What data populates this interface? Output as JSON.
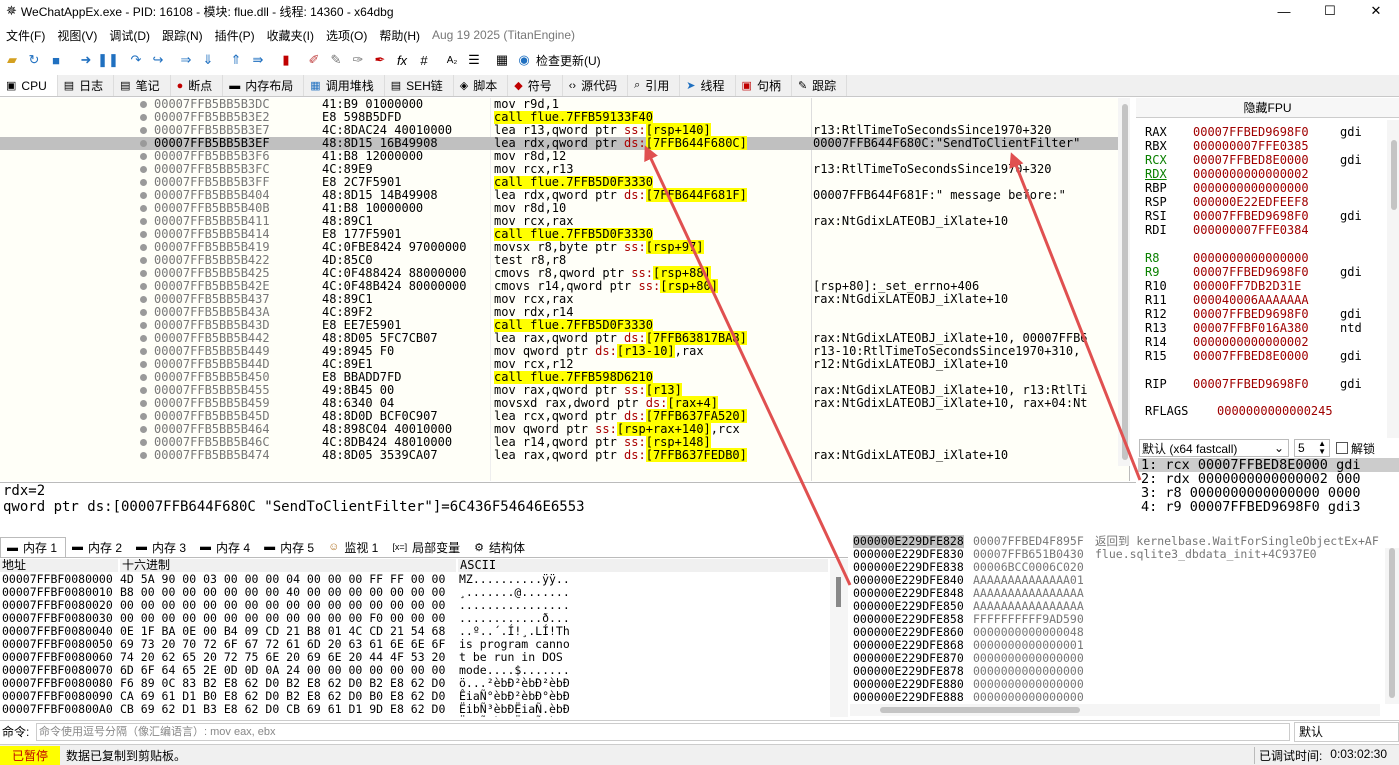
{
  "window": {
    "title": "WeChatAppEx.exe - PID: 16108 - 模块: flue.dll - 线程: 14360 - x64dbg",
    "buttons": [
      "—",
      "☐",
      "✕"
    ]
  },
  "menu": {
    "items": [
      "文件(F)",
      "视图(V)",
      "调试(D)",
      "跟踪(N)",
      "插件(P)",
      "收藏夹(I)",
      "选项(O)",
      "帮助(H)"
    ],
    "version": "Aug 19 2025 (TitanEngine)"
  },
  "toolbar": {
    "update_label": "检查更新(U)"
  },
  "tabs": [
    {
      "icon": "cpu-icon",
      "glyph": "▣",
      "label": "CPU"
    },
    {
      "icon": "log-icon",
      "glyph": "▤",
      "label": "日志"
    },
    {
      "icon": "notes-icon",
      "glyph": "▤",
      "label": "笔记"
    },
    {
      "icon": "breakpoint-icon",
      "glyph": "●",
      "label": "断点"
    },
    {
      "icon": "memory-map-icon",
      "glyph": "▬",
      "label": "内存布局"
    },
    {
      "icon": "callstack-icon",
      "glyph": "▦",
      "label": "调用堆栈"
    },
    {
      "icon": "seh-icon",
      "glyph": "▤",
      "label": "SEH链"
    },
    {
      "icon": "script-icon",
      "glyph": "◈",
      "label": "脚本"
    },
    {
      "icon": "symbol-icon",
      "glyph": "◆",
      "label": "符号"
    },
    {
      "icon": "source-icon",
      "glyph": "‹›",
      "label": "源代码"
    },
    {
      "icon": "references-icon",
      "glyph": "⌕",
      "label": "引用"
    },
    {
      "icon": "threads-icon",
      "glyph": "➤",
      "label": "线程"
    },
    {
      "icon": "handles-icon",
      "glyph": "▣",
      "label": "句柄"
    },
    {
      "icon": "trace-icon",
      "glyph": "✎",
      "label": "跟踪"
    }
  ],
  "disasm": [
    {
      "addr": "00007FFB5BB5B3DC",
      "bytes": "41:B9 01000000",
      "ins": "mov r9d,1",
      "cm": ""
    },
    {
      "addr": "00007FFB5BB5B3E2",
      "bytes": "E8 598B5DFD",
      "ins": "call flue.7FFB59133F40",
      "cm": "",
      "call": true
    },
    {
      "addr": "00007FFB5BB5B3E7",
      "bytes": "4C:8DAC24 40010000",
      "ins": "lea r13,qword ptr ss:[rsp+140]",
      "cm": "r13:RtlTimeToSecondsSince1970+320"
    },
    {
      "addr": "00007FFB5BB5B3EF",
      "bytes": "48:8D15 16B49908",
      "ins": "lea rdx,qword ptr ds:[7FFB644F680C]",
      "cm": "00007FFB644F680C:\"SendToClientFilter\"",
      "sel": true
    },
    {
      "addr": "00007FFB5BB5B3F6",
      "bytes": "41:B8 12000000",
      "ins": "mov r8d,12",
      "cm": ""
    },
    {
      "addr": "00007FFB5BB5B3FC",
      "bytes": "4C:89E9",
      "ins": "mov rcx,r13",
      "cm": "r13:RtlTimeToSecondsSince1970+320"
    },
    {
      "addr": "00007FFB5BB5B3FF",
      "bytes": "E8 2C7F5901",
      "ins": "call flue.7FFB5D0F3330",
      "cm": "",
      "call": true
    },
    {
      "addr": "00007FFB5BB5B404",
      "bytes": "48:8D15 14B49908",
      "ins": "lea rdx,qword ptr ds:[7FFB644F681F]",
      "cm": "00007FFB644F681F:\" message before:\""
    },
    {
      "addr": "00007FFB5BB5B40B",
      "bytes": "41:B8 10000000",
      "ins": "mov r8d,10",
      "cm": ""
    },
    {
      "addr": "00007FFB5BB5B411",
      "bytes": "48:89C1",
      "ins": "mov rcx,rax",
      "cm": "rax:NtGdixLATEOBJ_iXlate+10"
    },
    {
      "addr": "00007FFB5BB5B414",
      "bytes": "E8 177F5901",
      "ins": "call flue.7FFB5D0F3330",
      "cm": "",
      "call": true
    },
    {
      "addr": "00007FFB5BB5B419",
      "bytes": "4C:0FBE8424 97000000",
      "ins": "movsx r8,byte ptr ss:[rsp+97]",
      "cm": ""
    },
    {
      "addr": "00007FFB5BB5B422",
      "bytes": "4D:85C0",
      "ins": "test r8,r8",
      "cm": ""
    },
    {
      "addr": "00007FFB5BB5B425",
      "bytes": "4C:0F488424 88000000",
      "ins": "cmovs r8,qword ptr ss:[rsp+88]",
      "cm": ""
    },
    {
      "addr": "00007FFB5BB5B42E",
      "bytes": "4C:0F48B424 80000000",
      "ins": "cmovs r14,qword ptr ss:[rsp+80]",
      "cm": "[rsp+80]:_set_errno+406"
    },
    {
      "addr": "00007FFB5BB5B437",
      "bytes": "48:89C1",
      "ins": "mov rcx,rax",
      "cm": "rax:NtGdixLATEOBJ_iXlate+10"
    },
    {
      "addr": "00007FFB5BB5B43A",
      "bytes": "4C:89F2",
      "ins": "mov rdx,r14",
      "cm": ""
    },
    {
      "addr": "00007FFB5BB5B43D",
      "bytes": "E8 EE7E5901",
      "ins": "call flue.7FFB5D0F3330",
      "cm": "",
      "call": true
    },
    {
      "addr": "00007FFB5BB5B442",
      "bytes": "48:8D05 5FC7CB07",
      "ins": "lea rax,qword ptr ds:[7FFB63817BA8]",
      "cm": "rax:NtGdixLATEOBJ_iXlate+10, 00007FFB6"
    },
    {
      "addr": "00007FFB5BB5B449",
      "bytes": "49:8945 F0",
      "ins": "mov qword ptr ds:[r13-10],rax",
      "cm": "r13-10:RtlTimeToSecondsSince1970+310,"
    },
    {
      "addr": "00007FFB5BB5B44D",
      "bytes": "4C:89E1",
      "ins": "mov rcx,r12",
      "cm": "r12:NtGdixLATEOBJ_iXlate+10"
    },
    {
      "addr": "00007FFB5BB5B450",
      "bytes": "E8 BBADD7FD",
      "ins": "call flue.7FFB598D6210",
      "cm": "",
      "call": true
    },
    {
      "addr": "00007FFB5BB5B455",
      "bytes": "49:8B45 00",
      "ins": "mov rax,qword ptr ss:[r13]",
      "cm": "rax:NtGdixLATEOBJ_iXlate+10, r13:RtlTi"
    },
    {
      "addr": "00007FFB5BB5B459",
      "bytes": "48:6340 04",
      "ins": "movsxd rax,dword ptr ds:[rax+4]",
      "cm": "rax:NtGdixLATEOBJ_iXlate+10, rax+04:Nt"
    },
    {
      "addr": "00007FFB5BB5B45D",
      "bytes": "48:8D0D BCF0C907",
      "ins": "lea rcx,qword ptr ds:[7FFB637FA520]",
      "cm": ""
    },
    {
      "addr": "00007FFB5BB5B464",
      "bytes": "48:898C04 40010000",
      "ins": "mov qword ptr ss:[rsp+rax+140],rcx",
      "cm": ""
    },
    {
      "addr": "00007FFB5BB5B46C",
      "bytes": "4C:8DB424 48010000",
      "ins": "lea r14,qword ptr ss:[rsp+148]",
      "cm": ""
    },
    {
      "addr": "00007FFB5BB5B474",
      "bytes": "48:8D05 3539CA07",
      "ins": "lea rax,qword ptr ds:[7FFB637FEDB0]",
      "cm": "rax:NtGdixLATEOBJ_iXlate+10"
    }
  ],
  "regs": {
    "header": "隐藏FPU",
    "list": [
      {
        "n": "RAX",
        "v": "00007FFBED9698F0",
        "x": "gdi",
        "g": false
      },
      {
        "n": "RBX",
        "v": "000000007FFE0385",
        "x": "",
        "g": false
      },
      {
        "n": "RCX",
        "v": "00007FFBED8E0000",
        "x": "gdi",
        "g": true
      },
      {
        "n": "RDX",
        "v": "0000000000000002",
        "x": "",
        "g": true
      },
      {
        "n": "RBP",
        "v": "0000000000000000",
        "x": "",
        "g": false
      },
      {
        "n": "RSP",
        "v": "000000E22EDFEEF8",
        "x": "",
        "g": false
      },
      {
        "n": "RSI",
        "v": "00007FFBED9698F0",
        "x": "gdi",
        "g": false
      },
      {
        "n": "RDI",
        "v": "000000007FFE0384",
        "x": "",
        "g": false
      },
      {
        "n": "R8",
        "v": "0000000000000000",
        "x": "",
        "g": true
      },
      {
        "n": "R9",
        "v": "00007FFBED9698F0",
        "x": "gdi",
        "g": true
      },
      {
        "n": "R10",
        "v": "00000FF7DB2D31E",
        "x": "",
        "g": false
      },
      {
        "n": "R11",
        "v": "000040006AAAAAAA",
        "x": "",
        "g": false
      },
      {
        "n": "R12",
        "v": "00007FFBED9698F0",
        "x": "gdi",
        "g": false
      },
      {
        "n": "R13",
        "v": "00007FFBF016A380",
        "x": "ntd",
        "g": false
      },
      {
        "n": "R14",
        "v": "0000000000000002",
        "x": "",
        "g": false
      },
      {
        "n": "R15",
        "v": "00007FFBED8E0000",
        "x": "gdi",
        "g": false
      },
      {
        "n": "RIP",
        "v": "00007FFBED9698F0",
        "x": "gdi",
        "g": false
      }
    ],
    "rflags_label": "RFLAGS",
    "rflags_value": "0000000000000245"
  },
  "callconv": {
    "label": "默认 (x64 fastcall)",
    "count": "5",
    "unlock": "解锁"
  },
  "args": [
    "1: rcx 00007FFBED8E0000 gdi",
    "2: rdx 0000000000000002 000",
    "3: r8 0000000000000000 0000",
    "4: r9 00007FFBED9698F0 gdi3"
  ],
  "info": [
    "rdx=2",
    "qword ptr ds:[00007FFB644F680C \"SendToClientFilter\"]=6C436F54646E6553"
  ],
  "dumptabs": [
    {
      "icon": "memory-icon",
      "glyph": "▬",
      "label": "内存 1"
    },
    {
      "icon": "memory-icon",
      "glyph": "▬",
      "label": "内存 2"
    },
    {
      "icon": "memory-icon",
      "glyph": "▬",
      "label": "内存 3"
    },
    {
      "icon": "memory-icon",
      "glyph": "▬",
      "label": "内存 4"
    },
    {
      "icon": "memory-icon",
      "glyph": "▬",
      "label": "内存 5"
    },
    {
      "icon": "watch-icon",
      "glyph": "☺",
      "label": "监视 1"
    },
    {
      "icon": "locals-icon",
      "glyph": "[x=]",
      "label": "局部变量"
    },
    {
      "icon": "struct-icon",
      "glyph": "⚙",
      "label": "结构体"
    }
  ],
  "dump": {
    "headers": [
      "地址",
      "十六进制",
      "ASCII"
    ],
    "rows": [
      {
        "a": "00007FFBF0080000",
        "h": "4D 5A 90 00 03 00 00 00 04 00 00 00 FF FF 00 00",
        "s": "MZ..........ÿÿ.."
      },
      {
        "a": "00007FFBF0080010",
        "h": "B8 00 00 00 00 00 00 00 40 00 00 00 00 00 00 00",
        "s": "¸.......@......."
      },
      {
        "a": "00007FFBF0080020",
        "h": "00 00 00 00 00 00 00 00 00 00 00 00 00 00 00 00",
        "s": "................"
      },
      {
        "a": "00007FFBF0080030",
        "h": "00 00 00 00 00 00 00 00 00 00 00 00 F0 00 00 00",
        "s": "............ð..."
      },
      {
        "a": "00007FFBF0080040",
        "h": "0E 1F BA 0E 00 B4 09 CD 21 B8 01 4C CD 21 54 68",
        "s": "..º..´.Í!¸.LÍ!Th"
      },
      {
        "a": "00007FFBF0080050",
        "h": "69 73 20 70 72 6F 67 72 61 6D 20 63 61 6E 6E 6F",
        "s": "is program canno"
      },
      {
        "a": "00007FFBF0080060",
        "h": "74 20 62 65 20 72 75 6E 20 69 6E 20 44 4F 53 20",
        "s": "t be run in DOS "
      },
      {
        "a": "00007FFBF0080070",
        "h": "6D 6F 64 65 2E 0D 0D 0A 24 00 00 00 00 00 00 00",
        "s": "mode....$......."
      },
      {
        "a": "00007FFBF0080080",
        "h": "F6 89 0C 83 B2 E8 62 D0 B2 E8 62 D0 B2 E8 62 D0",
        "s": "ö...²èbÐ²èbÐ²èbÐ"
      },
      {
        "a": "00007FFBF0080090",
        "h": "CA 69 61 D1 B0 E8 62 D0 B2 E8 62 D0 B0 E8 62 D0",
        "s": "ÊiaÑ°èbÐ²èbÐ°èbÐ"
      },
      {
        "a": "00007FFBF00800A0",
        "h": "CB 69 62 D1 B3 E8 62 D0 CB 69 61 D1 9D E8 62 D0",
        "s": "ËibÑ³èbÐËiaÑ.èbÐ"
      },
      {
        "a": "00007FFBF00800B0",
        "h": "CB 69 66 D1 B8 E8 62 D0 CB 69 67 D1 B8 E8 62 D0",
        "s": "ËifÑ¸èbÐËigÑ¸èbÐ"
      }
    ]
  },
  "stack": [
    {
      "a": "000000E229DFE828",
      "v": "00007FFBED4F895F",
      "c": "返回到 kernelbase.WaitForSingleObjectEx+AF"
    },
    {
      "a": "000000E229DFE830",
      "v": "00007FFB651B0430",
      "c": "flue.sqlite3_dbdata_init+4C937E0"
    },
    {
      "a": "000000E229DFE838",
      "v": "00006BCC0006C020",
      "c": ""
    },
    {
      "a": "000000E229DFE840",
      "v": "AAAAAAAAAAAAAA01",
      "c": ""
    },
    {
      "a": "000000E229DFE848",
      "v": "AAAAAAAAAAAAAAAA",
      "c": ""
    },
    {
      "a": "000000E229DFE850",
      "v": "AAAAAAAAAAAAAAAA",
      "c": ""
    },
    {
      "a": "000000E229DFE858",
      "v": "FFFFFFFFFF9AD590",
      "c": ""
    },
    {
      "a": "000000E229DFE860",
      "v": "0000000000000048",
      "c": ""
    },
    {
      "a": "000000E229DFE868",
      "v": "0000000000000001",
      "c": ""
    },
    {
      "a": "000000E229DFE870",
      "v": "0000000000000000",
      "c": ""
    },
    {
      "a": "000000E229DFE878",
      "v": "0000000000000000",
      "c": ""
    },
    {
      "a": "000000E229DFE880",
      "v": "0000000000000000",
      "c": ""
    },
    {
      "a": "000000E229DFE888",
      "v": "0000000000000000",
      "c": ""
    }
  ],
  "cmd": {
    "label": "命令:",
    "placeholder": "命令使用逗号分隔（像汇编语言）: mov eax, ebx",
    "default": "默认"
  },
  "status": {
    "state": "已暂停",
    "message": "数据已复制到剪贴板。",
    "time_label": "已调试时间:",
    "time_value": "0:03:02:30"
  },
  "colors": {
    "arrow": "#e05050",
    "paused_bg": "#ffff00",
    "register_value": "#a00000"
  }
}
